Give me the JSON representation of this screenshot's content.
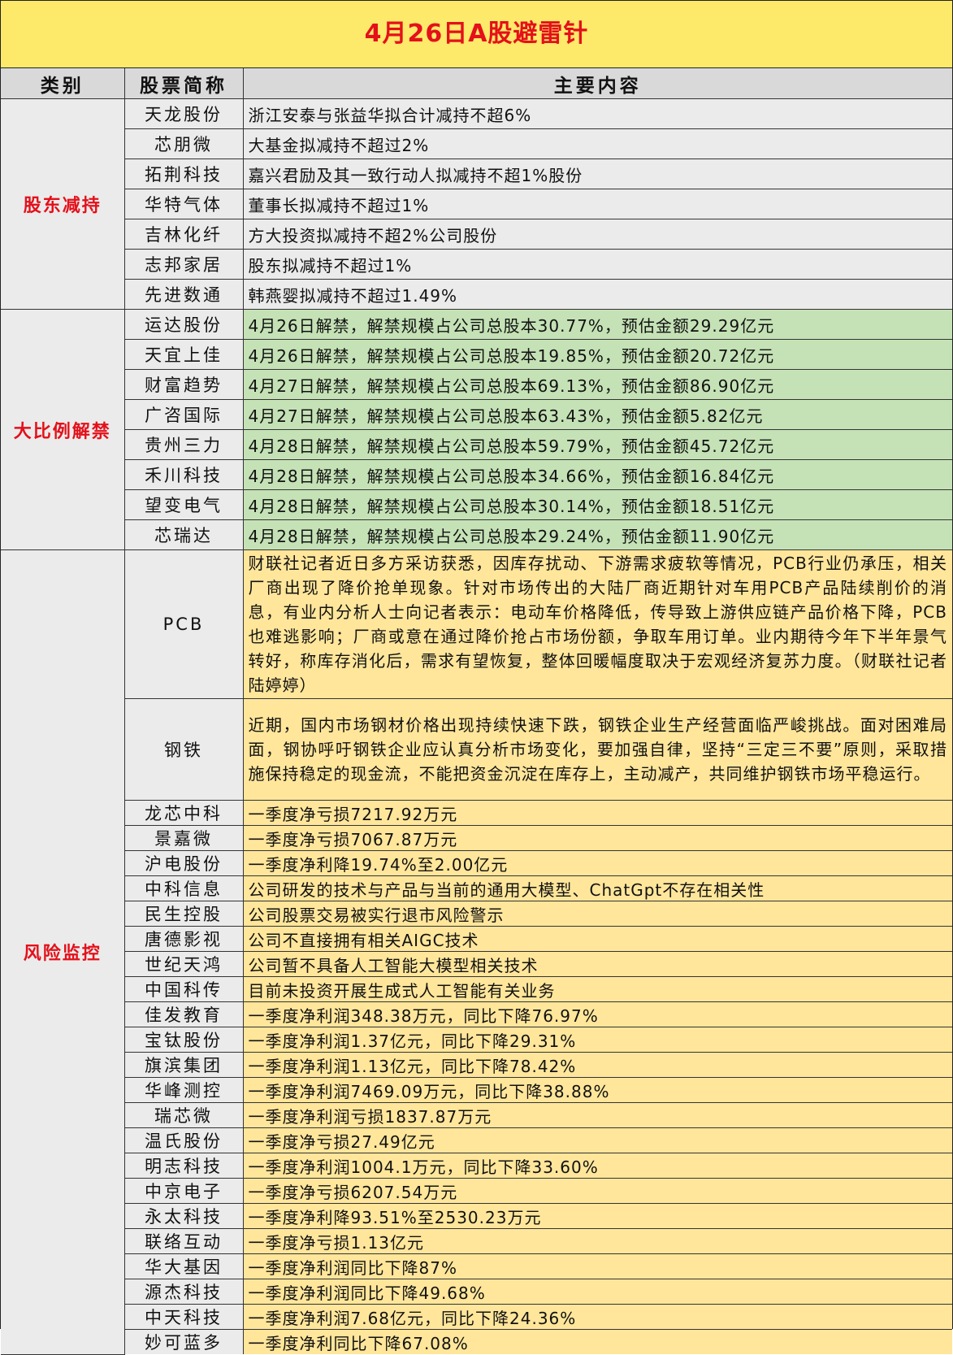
{
  "title": "4月26日A股避雷针",
  "headers": [
    "类别",
    "股票简称",
    "主要内容"
  ],
  "sections": [
    {
      "category": "股东减持",
      "rows": [
        {
          "name": "天龙股份",
          "content": "浙江安泰与张益华拟合计减持不超6%"
        },
        {
          "name": "芯朋微",
          "content": "大基金拟减持不超过2%"
        },
        {
          "name": "拓荆科技",
          "content": "嘉兴君励及其一致行动人拟减持不超1%股份"
        },
        {
          "name": "华特气体",
          "content": "董事长拟减持不超过1%"
        },
        {
          "name": "吉林化纤",
          "content": "方大投资拟减持不超2%公司股份"
        },
        {
          "name": "志邦家居",
          "content": "股东拟减持不超过1%"
        },
        {
          "name": "先进数通",
          "content": "韩燕婴拟减持不超过1.49%"
        }
      ]
    },
    {
      "category": "大比例解禁",
      "rows": [
        {
          "name": "运达股份",
          "content": "4月26日解禁，解禁规模占公司总股本30.77%，预估金额29.29亿元"
        },
        {
          "name": "天宜上佳",
          "content": "4月26日解禁，解禁规模占公司总股本19.85%，预估金额20.72亿元"
        },
        {
          "name": "财富趋势",
          "content": "4月27日解禁，解禁规模占公司总股本69.13%，预估金额86.90亿元"
        },
        {
          "name": "广咨国际",
          "content": "4月27日解禁，解禁规模占公司总股本63.43%，预估金额5.82亿元"
        },
        {
          "name": "贵州三力",
          "content": "4月28日解禁，解禁规模占公司总股本59.79%，预估金额45.72亿元"
        },
        {
          "name": "禾川科技",
          "content": "4月28日解禁，解禁规模占公司总股本34.66%，预估金额16.84亿元"
        },
        {
          "name": "望变电气",
          "content": "4月28日解禁，解禁规模占公司总股本30.14%，预估金额18.51亿元"
        },
        {
          "name": "芯瑞达",
          "content": "4月28日解禁，解禁规模占公司总股本29.24%，预估金额11.90亿元"
        }
      ]
    },
    {
      "category": "风险监控",
      "rows": [
        {
          "name": "PCB",
          "content": "财联社记者近日多方采访获悉，因库存扰动、下游需求疲软等情况，PCB行业仍承压，相关厂商出现了降价抢单现象。针对市场传出的大陆厂商近期针对车用PCB产品陆续削价的消息，有业内分析人士向记者表示：电动车价格降低，传导致上游供应链产品价格下降，PCB也难逃影响；厂商或意在通过降价抢占市场份额，争取车用订单。业内期待今年下半年景气转好，称库存消化后，需求有望恢复，整体回暖幅度取决于宏观经济复苏力度。（财联社记者 陆婷婷）"
        },
        {
          "name": "钢铁",
          "content": "近期，国内市场钢材价格出现持续快速下跌，钢铁企业生产经营面临严峻挑战。面对困难局面，钢协呼吁钢铁企业应认真分析市场变化，要加强自律，坚持“三定三不要”原则，采取措施保持稳定的现金流，不能把资金沉淀在库存上，主动减产，共同维护钢铁市场平稳运行。"
        },
        {
          "name": "龙芯中科",
          "content": "一季度净亏损7217.92万元"
        },
        {
          "name": "景嘉微",
          "content": "一季度净亏损7067.87万元"
        },
        {
          "name": "沪电股份",
          "content": "一季度净利降19.74%至2.00亿元"
        },
        {
          "name": "中科信息",
          "content": "公司研发的技术与产品与当前的通用大模型、ChatGpt不存在相关性"
        },
        {
          "name": "民生控股",
          "content": "公司股票交易被实行退市风险警示"
        },
        {
          "name": "唐德影视",
          "content": "公司不直接拥有相关AIGC技术"
        },
        {
          "name": "世纪天鸿",
          "content": "公司暂不具备人工智能大模型相关技术"
        },
        {
          "name": "中国科传",
          "content": "目前未投资开展生成式人工智能有关业务"
        },
        {
          "name": "佳发教育",
          "content": "一季度净利润348.38万元，同比下降76.97%"
        },
        {
          "name": "宝钛股份",
          "content": "一季度净利润1.37亿元，同比下降29.31%"
        },
        {
          "name": "旗滨集团",
          "content": "一季度净利润1.13亿元，同比下降78.42%"
        },
        {
          "name": "华峰测控",
          "content": "一季度净利润7469.09万元，同比下降38.88%"
        },
        {
          "name": "瑞芯微",
          "content": "一季度净利润亏损1837.87万元"
        },
        {
          "name": "温氏股份",
          "content": "一季度净亏损27.49亿元"
        },
        {
          "name": "明志科技",
          "content": "一季度净利润1004.1万元，同比下降33.60%"
        },
        {
          "name": "中京电子",
          "content": "一季度净亏损6207.54万元"
        },
        {
          "name": "永太科技",
          "content": "一季度净利降93.51%至2530.23万元"
        },
        {
          "name": "联络互动",
          "content": "一季度净亏损1.13亿元"
        },
        {
          "name": "华大基因",
          "content": "一季度净利润同比下降87%"
        },
        {
          "name": "源杰科技",
          "content": "一季度净利润同比下降49.68%"
        },
        {
          "name": "中天科技",
          "content": "一季度净利润7.68亿元，同比下降24.36%"
        },
        {
          "name": "妙可蓝多",
          "content": "一季度净利同比下降67.08%"
        }
      ]
    }
  ]
}
